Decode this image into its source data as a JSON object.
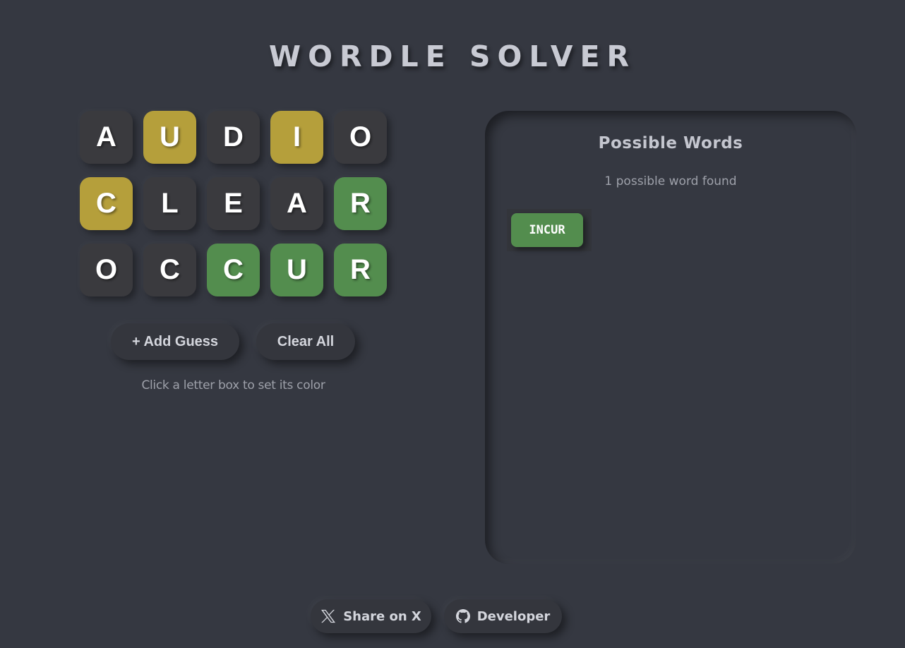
{
  "header": {
    "title": "WORDLE SOLVER"
  },
  "grid": {
    "rows": [
      [
        {
          "letter": "A",
          "state": "gray"
        },
        {
          "letter": "U",
          "state": "yellow"
        },
        {
          "letter": "D",
          "state": "gray"
        },
        {
          "letter": "I",
          "state": "yellow"
        },
        {
          "letter": "O",
          "state": "gray"
        }
      ],
      [
        {
          "letter": "C",
          "state": "yellow"
        },
        {
          "letter": "L",
          "state": "gray"
        },
        {
          "letter": "E",
          "state": "gray"
        },
        {
          "letter": "A",
          "state": "gray"
        },
        {
          "letter": "R",
          "state": "green"
        }
      ],
      [
        {
          "letter": "O",
          "state": "gray"
        },
        {
          "letter": "C",
          "state": "gray"
        },
        {
          "letter": "C",
          "state": "green"
        },
        {
          "letter": "U",
          "state": "green"
        },
        {
          "letter": "R",
          "state": "green"
        }
      ]
    ]
  },
  "controls": {
    "add_guess_label": "+ Add Guess",
    "clear_all_label": "Clear All",
    "hint": "Click a letter box to set its color"
  },
  "results": {
    "title": "Possible Words",
    "count_text": "1 possible word found",
    "words": [
      "INCUR"
    ]
  },
  "footer": {
    "share_label": "Share on X",
    "share_icon": "x-logo-icon",
    "developer_label": "Developer",
    "developer_icon": "github-icon"
  },
  "colors": {
    "background": "#353841",
    "tile_gray": "#3a3a3e",
    "tile_yellow": "#b59f3b",
    "tile_green": "#538d4e",
    "text": "#c8cad3"
  }
}
